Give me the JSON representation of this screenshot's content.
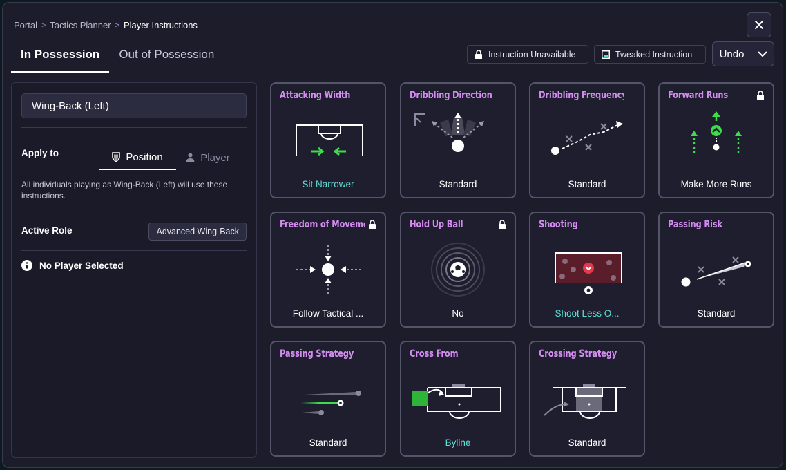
{
  "breadcrumb": {
    "items": [
      "Portal",
      "Tactics Planner",
      "Player Instructions"
    ]
  },
  "tabs": [
    {
      "label": "In Possession",
      "active": true
    },
    {
      "label": "Out of Possession",
      "active": false
    }
  ],
  "legend": {
    "unavailable": "Instruction Unavailable",
    "tweaked": "Tweaked Instruction"
  },
  "undo": {
    "label": "Undo"
  },
  "left_panel": {
    "position_value": "Wing-Back (Left)",
    "apply_to_label": "Apply to",
    "apply_options": [
      {
        "label": "Position",
        "icon": "shield-icon",
        "active": true
      },
      {
        "label": "Player",
        "icon": "person-icon",
        "active": false
      }
    ],
    "apply_description": "All individuals playing as Wing-Back (Left) will use these instructions.",
    "active_role_label": "Active Role",
    "active_role_value": "Advanced Wing-Back",
    "no_player_text": "No Player Selected"
  },
  "cards": [
    {
      "title": "Attacking Width",
      "value": "Sit Narrower",
      "tweaked": true,
      "locked": false
    },
    {
      "title": "Dribbling Direction",
      "value": "Standard",
      "tweaked": false,
      "locked": false
    },
    {
      "title": "Dribbling Frequency",
      "value": "Standard",
      "tweaked": false,
      "locked": false
    },
    {
      "title": "Forward Runs",
      "value": "Make More Runs",
      "tweaked": false,
      "locked": true
    },
    {
      "title": "Freedom of Movement",
      "value": "Follow Tactical ...",
      "tweaked": false,
      "locked": true
    },
    {
      "title": "Hold Up Ball",
      "value": "No",
      "tweaked": false,
      "locked": true
    },
    {
      "title": "Shooting",
      "value": "Shoot Less O...",
      "tweaked": true,
      "locked": false
    },
    {
      "title": "Passing Risk",
      "value": "Standard",
      "tweaked": false,
      "locked": false
    },
    {
      "title": "Passing Strategy",
      "value": "Standard",
      "tweaked": false,
      "locked": false
    },
    {
      "title": "Cross From",
      "value": "Byline",
      "tweaked": true,
      "locked": false
    },
    {
      "title": "Crossing Strategy",
      "value": "Standard",
      "tweaked": false,
      "locked": false
    }
  ],
  "colors": {
    "title_accent": "#d48cf0",
    "tweaked_value": "#5ee0d8",
    "green_accent": "#3ddc4a",
    "breadcrumb_active_sep": "#b08cff"
  }
}
